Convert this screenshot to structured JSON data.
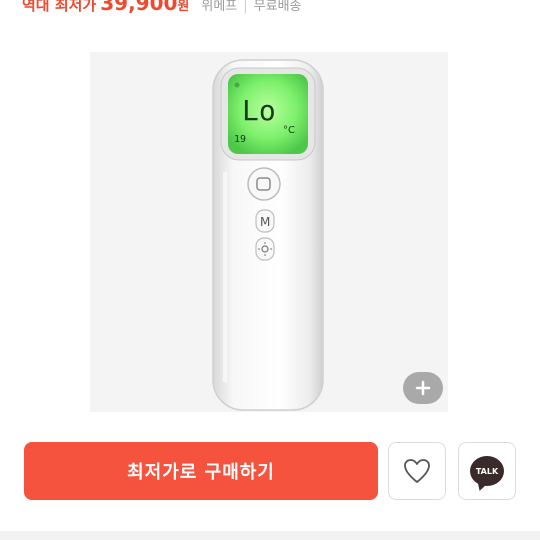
{
  "price": {
    "label": "역대 최저가",
    "value": "39,900",
    "unit": "원",
    "seller": "위메프",
    "shipping": "무료배송"
  },
  "product": {
    "display_text": "Lo",
    "display_unit": "°C",
    "display_small": "19",
    "mode_button_label": "M",
    "display_color": "#7cf06b",
    "icons": [
      "zoom-plus-icon",
      "heart-icon",
      "kakao-talk-icon"
    ]
  },
  "actions": {
    "buy_label": "최저가로 구매하기",
    "talk_label": "TALK"
  },
  "colors": {
    "accent": "#f5533d",
    "price": "#ee4a2f"
  }
}
